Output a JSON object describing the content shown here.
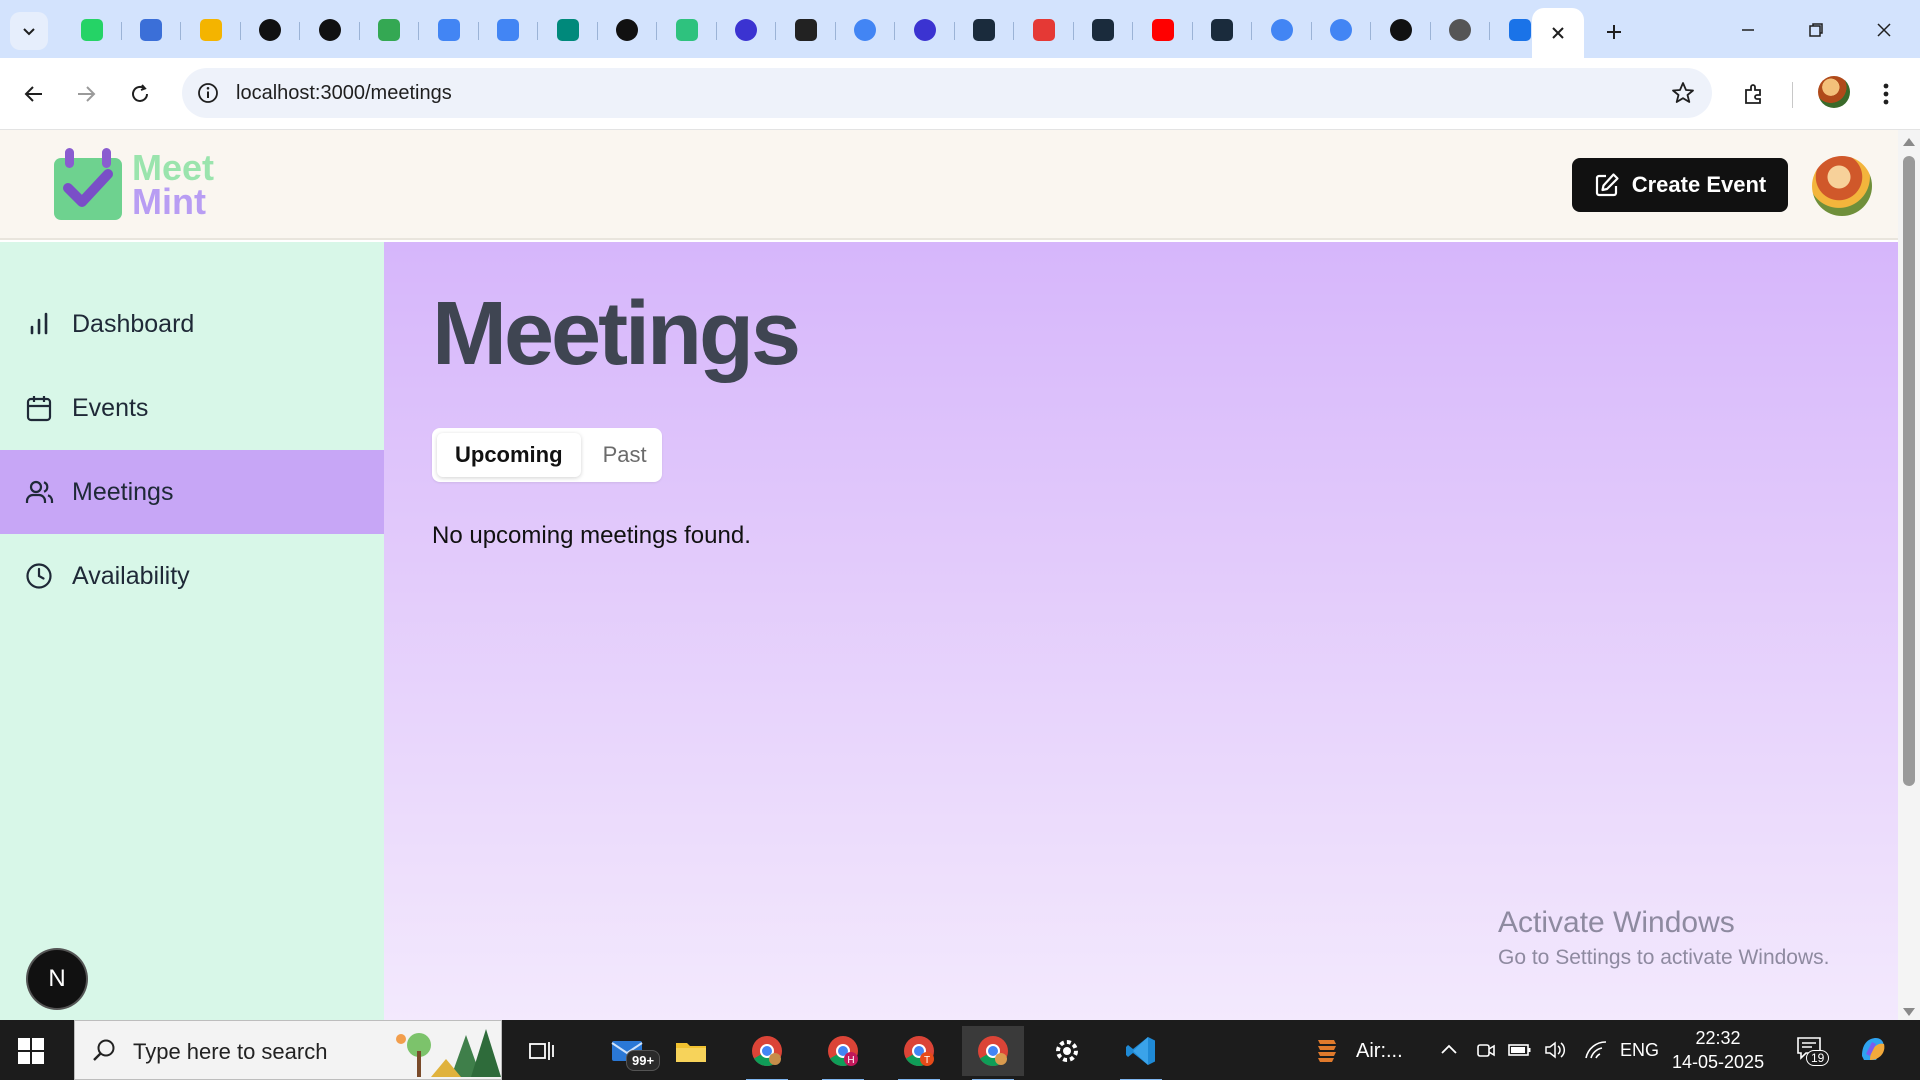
{
  "browser": {
    "tabs": [
      {
        "icon": "whatsapp-icon",
        "color": "#25d366"
      },
      {
        "icon": "puzzle-extension-icon",
        "color": "#3b6fd8"
      },
      {
        "icon": "slides-icon",
        "color": "#f4b400"
      },
      {
        "icon": "mongodb-icon",
        "color": "#111111"
      },
      {
        "icon": "openai-icon",
        "color": "#111111"
      },
      {
        "icon": "google-drive-icon",
        "color": "#34a853"
      },
      {
        "icon": "google-docs-icon",
        "color": "#4285f4"
      },
      {
        "icon": "google-docs-icon",
        "color": "#4285f4"
      },
      {
        "icon": "google-meet-icon",
        "color": "#00897b"
      },
      {
        "icon": "github-icon",
        "color": "#111111"
      },
      {
        "icon": "notion-icon",
        "color": "#2ec27e"
      },
      {
        "icon": "clerk-icon",
        "color": "#3b33d1"
      },
      {
        "icon": "pen-icon",
        "color": "#222222"
      },
      {
        "icon": "google-icon",
        "color": "#4285f4"
      },
      {
        "icon": "clerk-icon",
        "color": "#3b33d1"
      },
      {
        "icon": "prisma-icon",
        "color": "#1a2b3c"
      },
      {
        "icon": "cloud-icon",
        "color": "#e53935"
      },
      {
        "icon": "prisma-icon",
        "color": "#1a2b3c"
      },
      {
        "icon": "youtube-icon",
        "color": "#ff0000"
      },
      {
        "icon": "prisma-icon",
        "color": "#1a2b3c"
      },
      {
        "icon": "google-icon",
        "color": "#4285f4"
      },
      {
        "icon": "google-icon",
        "color": "#4285f4"
      },
      {
        "icon": "openai-icon",
        "color": "#111111"
      },
      {
        "icon": "chrome-icon",
        "color": "#555555"
      },
      {
        "icon": "calendar-icon",
        "color": "#1a73e8"
      }
    ],
    "address": {
      "url": "localhost:3000/meetings"
    }
  },
  "app": {
    "logo": {
      "line1": "Meet",
      "line2": "Mint"
    },
    "header": {
      "create_label": "Create Event"
    },
    "sidebar": {
      "items": [
        {
          "label": "Dashboard",
          "icon": "bar-chart-icon",
          "active": false
        },
        {
          "label": "Events",
          "icon": "calendar-icon",
          "active": false
        },
        {
          "label": "Meetings",
          "icon": "users-icon",
          "active": true
        },
        {
          "label": "Availability",
          "icon": "clock-icon",
          "active": false
        }
      ],
      "user_initial": "N"
    },
    "main": {
      "title": "Meetings",
      "tabs": [
        {
          "label": "Upcoming",
          "active": true
        },
        {
          "label": "Past",
          "active": false
        }
      ],
      "empty_message": "No upcoming meetings found."
    },
    "watermark": {
      "title": "Activate Windows",
      "subtitle": "Go to Settings to activate Windows."
    }
  },
  "taskbar": {
    "search_placeholder": "Type here to search",
    "mail_badge": "99+",
    "running_app_label": "Air:...",
    "language": "ENG",
    "time": "22:32",
    "date": "14-05-2025",
    "notification_count": "19"
  },
  "colors": {
    "accent_green": "#9ae4ad",
    "accent_purple": "#b89df3",
    "sidebar_bg": "#d8f7e8",
    "active_nav": "#c7a6f6"
  }
}
